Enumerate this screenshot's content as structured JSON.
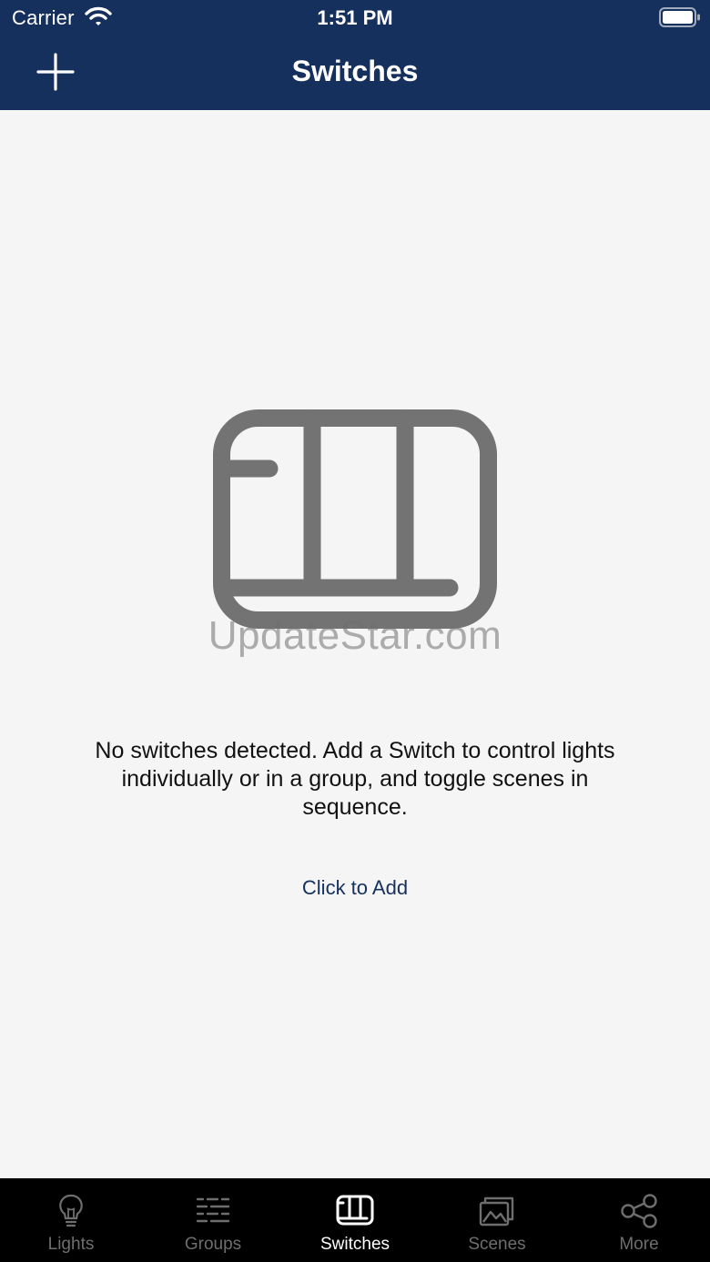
{
  "status_bar": {
    "carrier": "Carrier",
    "time": "1:51 PM"
  },
  "nav": {
    "title": "Switches",
    "add_icon": "plus-icon"
  },
  "empty_state": {
    "icon": "switch-panel-icon",
    "watermark": "UpdateStar.com",
    "message": "No switches detected. Add a Switch to control lights individually or in a group, and toggle scenes in sequence.",
    "action_label": "Click to Add"
  },
  "tabs": [
    {
      "label": "Lights",
      "icon": "lightbulb-icon",
      "active": false
    },
    {
      "label": "Groups",
      "icon": "groups-grid-icon",
      "active": false
    },
    {
      "label": "Switches",
      "icon": "switch-icon",
      "active": true
    },
    {
      "label": "Scenes",
      "icon": "scenes-image-icon",
      "active": false
    },
    {
      "label": "More",
      "icon": "share-nodes-icon",
      "active": false
    }
  ],
  "colors": {
    "nav_background": "#16305e",
    "content_background": "#f5f5f5",
    "tabbar_background": "#000000",
    "tab_active": "#ffffff",
    "tab_inactive": "#6e6e6e",
    "link": "#16305e",
    "empty_icon": "#737373"
  }
}
